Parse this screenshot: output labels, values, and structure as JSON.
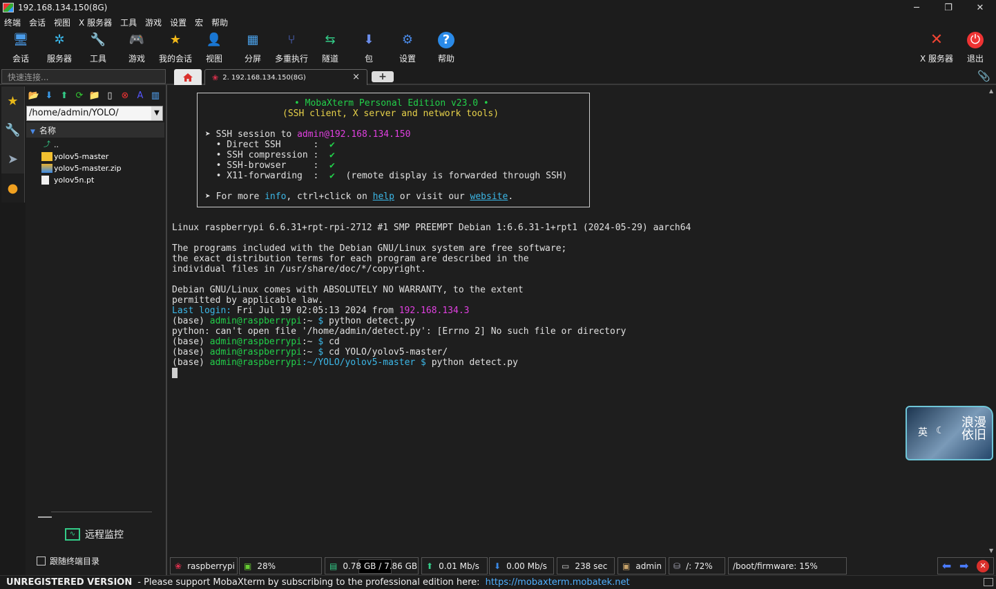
{
  "window": {
    "title": "192.168.134.150(8G)",
    "min": "─",
    "max": "❐",
    "close": "✕"
  },
  "menu": [
    "终端",
    "会话",
    "视图",
    "X 服务器",
    "工具",
    "游戏",
    "设置",
    "宏",
    "帮助"
  ],
  "toolbar": {
    "items": [
      {
        "label": "会话",
        "icon": "session-icon",
        "glyph": "🖥"
      },
      {
        "label": "服务器",
        "icon": "servers-icon",
        "glyph": "✲"
      },
      {
        "label": "工具",
        "icon": "tools-icon",
        "glyph": "🔧"
      },
      {
        "label": "游戏",
        "icon": "games-icon",
        "glyph": "🎮"
      },
      {
        "label": "我的会话",
        "icon": "star-icon",
        "glyph": "★"
      },
      {
        "label": "视图",
        "icon": "view-icon",
        "glyph": "👤"
      },
      {
        "label": "分屏",
        "icon": "split-icon",
        "glyph": "▦"
      },
      {
        "label": "多重执行",
        "icon": "multiexec-icon",
        "glyph": "⑂"
      },
      {
        "label": "隧道",
        "icon": "tunnel-icon",
        "glyph": "⇆"
      },
      {
        "label": "包",
        "icon": "packages-icon",
        "glyph": "⬇"
      },
      {
        "label": "设置",
        "icon": "settings-icon",
        "glyph": "⚙"
      },
      {
        "label": "帮助",
        "icon": "help-icon",
        "glyph": "?"
      }
    ],
    "xserver": {
      "label": "X 服务器",
      "glyph": "✕"
    },
    "exit": {
      "label": "退出",
      "glyph": "⏻"
    }
  },
  "quick_connect": {
    "placeholder": "快速连接..."
  },
  "tabs": {
    "session_label": "2. 192.168.134.150(8G)",
    "close": "×",
    "new": "+"
  },
  "sftp": {
    "path": "/home/admin/YOLO/",
    "column_header": "名称",
    "files": [
      {
        "name": "..",
        "icon": "parent-folder-icon"
      },
      {
        "name": "yolov5-master",
        "icon": "folder-icon"
      },
      {
        "name": "yolov5-master.zip",
        "icon": "zip-icon"
      },
      {
        "name": "yolov5n.pt",
        "icon": "file-icon"
      }
    ],
    "monitor_label": "远程监控",
    "follow_label": "跟随终端目录"
  },
  "terminal": {
    "banner_title": "• MobaXterm Personal Edition v23.0 •",
    "banner_sub": "(SSH client, X server and network tools)",
    "ssh_prefix": "➤ SSH session to ",
    "ssh_target": "admin@192.168.134.150",
    "opt1": "  • Direct SSH      :  ",
    "opt2": "  • SSH compression :  ",
    "opt3": "  • SSH-browser     :  ",
    "opt4": "  • X11-forwarding  :  ",
    "check": "✔",
    "x11_note": "  (remote display is forwarded through SSH)",
    "more_a": "➤ For more ",
    "more_info": "info",
    "more_b": ", ctrl+click on ",
    "more_help": "help",
    "more_c": " or visit our ",
    "more_web": "website",
    "more_d": ".",
    "l_linux": "Linux raspberrypi 6.6.31+rpt-rpi-2712 #1 SMP PREEMPT Debian 1:6.6.31-1+rpt1 (2024-05-29) aarch64",
    "l_p1": "The programs included with the Debian GNU/Linux system are free software;",
    "l_p2": "the exact distribution terms for each program are described in the",
    "l_p3": "individual files in /usr/share/doc/*/copyright.",
    "l_w1": "Debian GNU/Linux comes with ABSOLUTELY NO WARRANTY, to the extent",
    "l_w2": "permitted by applicable law.",
    "last_label": "Last login:",
    "last_text": " Fri Jul 19 02:05:13 2024 from ",
    "last_ip": "192.168.134.3",
    "base": "(base) ",
    "user": "admin@raspberrypi",
    "home": ":~",
    "dollar": " $ ",
    "cmd1": "python detect.py",
    "err": "python: can't open file '/home/admin/detect.py': [Errno 2] No such file or directory",
    "cmd2": "cd",
    "cmd3": "cd YOLO/yolov5-master/",
    "path4": ":~/YOLO/yolov5-master",
    "cmd4": "python detect.py"
  },
  "widget": {
    "left": "英",
    "moon": "☾",
    "right": "浪漫依旧"
  },
  "statusbar": {
    "host": "raspberrypi",
    "cpu": "28%",
    "mem": "0.78 GB / 7.86 GB",
    "up": "0.01 Mb/s",
    "down": "0.00 Mb/s",
    "uptime": "238 sec",
    "user": "admin",
    "root_disk": "/: 72%",
    "boot_disk": "/boot/firmware: 15%",
    "prev": "⬅",
    "next": "➡",
    "close": "✕"
  },
  "footer": {
    "unregistered": "UNREGISTERED VERSION",
    "message": " -  Please support MobaXterm by subscribing to the professional edition here:",
    "link": "https://mobaxterm.mobatek.net"
  },
  "colors": {
    "prompt_green": "#22d04a",
    "ip_magenta": "#e040e0",
    "cyan": "#3cb8e8",
    "check_yellow": "#e8d24a"
  }
}
